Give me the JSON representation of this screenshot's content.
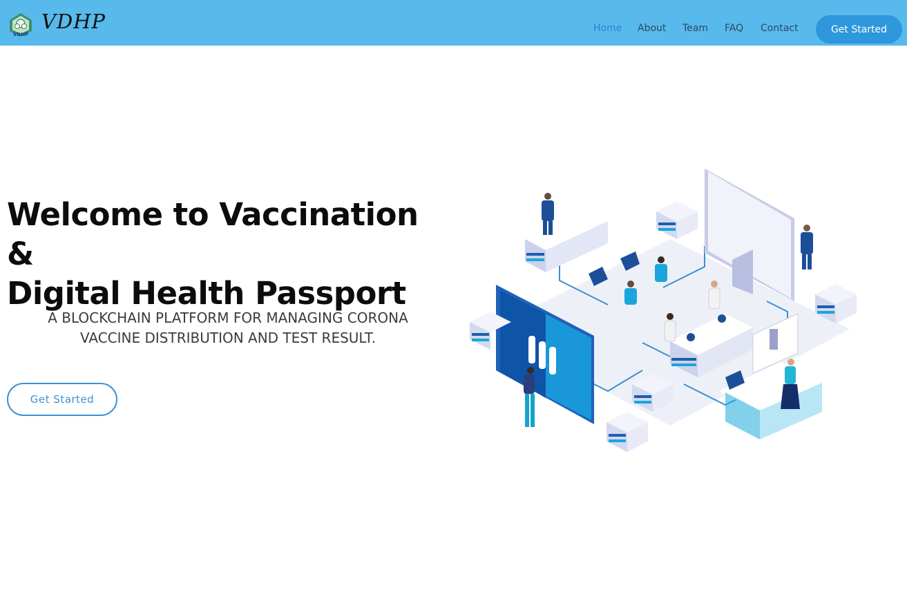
{
  "brand": {
    "name": "VDHP",
    "logo_caption": "VDHP",
    "icon": "vdhp-logo-icon"
  },
  "nav": {
    "items": [
      {
        "label": "Home",
        "active": true
      },
      {
        "label": "About",
        "active": false
      },
      {
        "label": "Team",
        "active": false
      },
      {
        "label": "FAQ",
        "active": false
      },
      {
        "label": "Contact",
        "active": false
      }
    ],
    "cta_label": "Get Started"
  },
  "hero": {
    "title_line1": "Welcome to Vaccination &",
    "title_line2": "Digital Health Passport",
    "subtitle_line1": "A BLOCKCHAIN PLATFORM FOR MANAGING CORONA",
    "subtitle_line2": "VACCINE DISTRIBUTION AND TEST RESULT.",
    "cta_label": "Get Started"
  },
  "colors": {
    "navbar_bg": "#58b9ec",
    "accent": "#2f97db",
    "active_link": "#2f7fd1"
  }
}
